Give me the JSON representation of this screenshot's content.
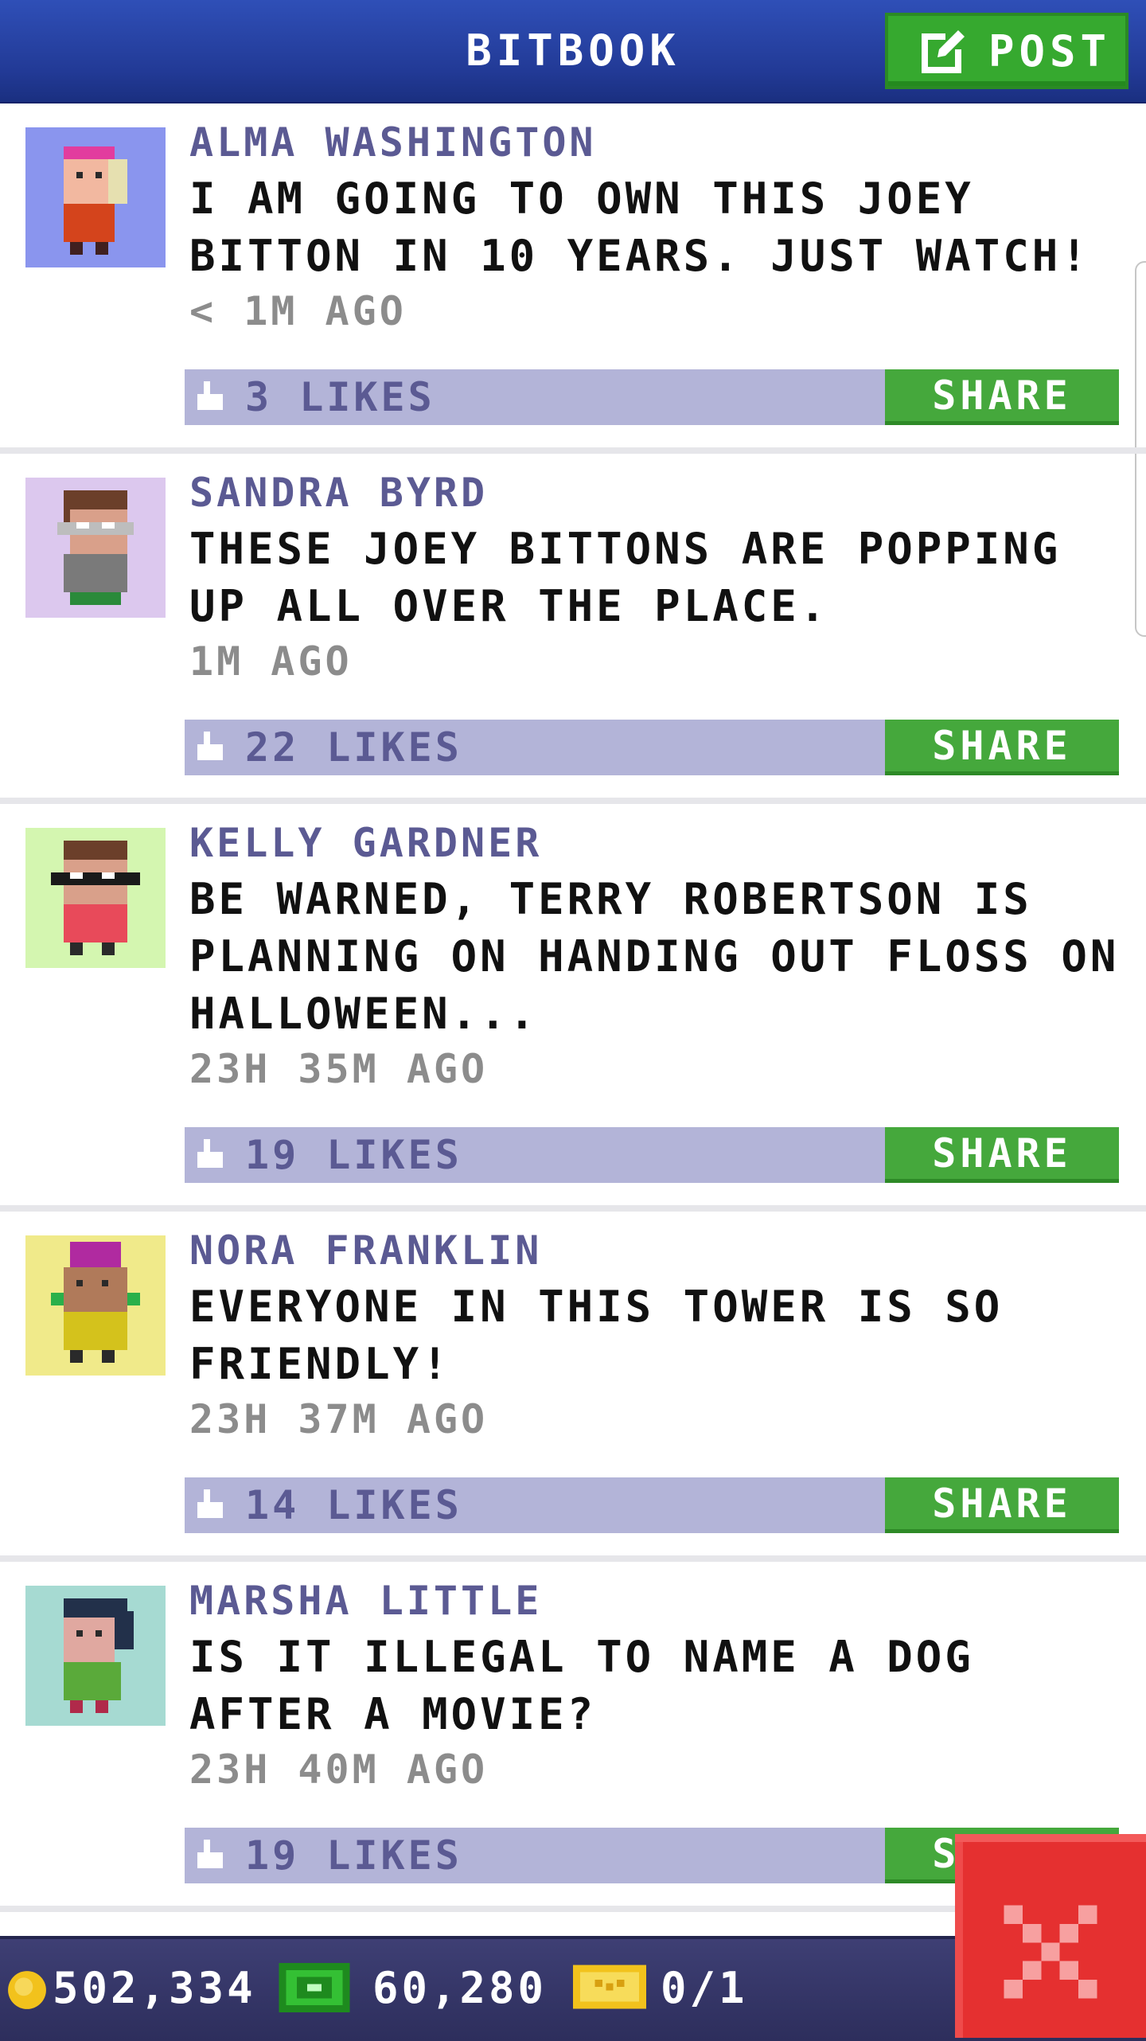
{
  "header": {
    "title": "BITBOOK",
    "post_label": "POST"
  },
  "posts": [
    {
      "name": "ALMA WASHINGTON",
      "message": "I AM GOING TO OWN THIS JOEY BITTON IN 10 YEARS. JUST WATCH!",
      "time": "< 1M AGO",
      "likes": "3 LIKES",
      "share_label": "SHARE",
      "avatar_bg": "#8a95ee"
    },
    {
      "name": "SANDRA BYRD",
      "message": "THESE JOEY BITTONS ARE POPPING UP ALL OVER THE PLACE.",
      "time": "1M AGO",
      "likes": "22 LIKES",
      "share_label": "SHARE",
      "avatar_bg": "#dcc8ee"
    },
    {
      "name": "KELLY GARDNER",
      "message": "BE WARNED, TERRY ROBERTSON IS PLANNING ON HANDING OUT FLOSS ON HALLOWEEN...",
      "time": "23H 35M AGO",
      "likes": "19 LIKES",
      "share_label": "SHARE",
      "avatar_bg": "#d4f6b0"
    },
    {
      "name": "NORA FRANKLIN",
      "message": "EVERYONE IN THIS TOWER IS SO FRIENDLY!",
      "time": "23H 37M AGO",
      "likes": "14 LIKES",
      "share_label": "SHARE",
      "avatar_bg": "#f0ea8a"
    },
    {
      "name": "MARSHA LITTLE",
      "message": "IS IT ILLEGAL TO NAME A DOG AFTER A MOVIE?",
      "time": "23H 40M AGO",
      "likes": "19 LIKES",
      "share_label": "SHARE",
      "avatar_bg": "#a6dad2"
    }
  ],
  "footer": {
    "coins": "502,334",
    "bux": "60,280",
    "tickets": "0/1"
  },
  "icons": {
    "post": "edit-icon",
    "like": "thumbs-up-icon",
    "coin": "coin-icon",
    "bux": "bitbux-icon",
    "ticket": "golden-ticket-icon",
    "close": "close-icon"
  },
  "colors": {
    "header": "#223a96",
    "accent_green": "#45a83c",
    "name_purple": "#5b5a93",
    "like_bar": "#b3b4d8",
    "footer": "#2d2e5c",
    "close_red": "#e53030"
  }
}
